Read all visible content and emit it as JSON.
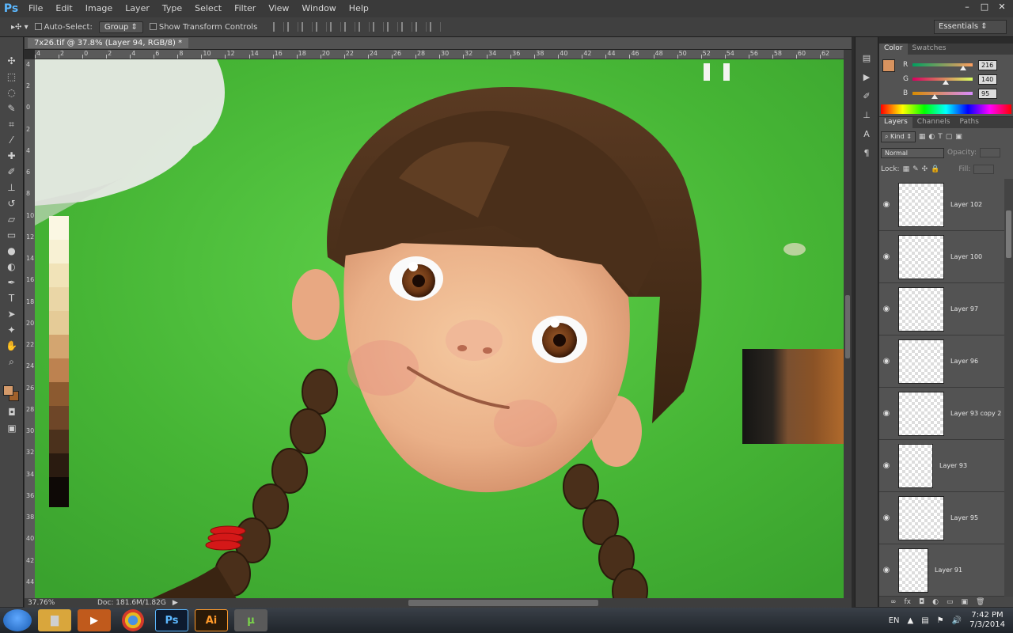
{
  "app": {
    "logo": "Ps",
    "doc_tab": "7x26.tif @ 37.8% (Layer 94, RGB/8) *"
  },
  "menu": [
    "File",
    "Edit",
    "Image",
    "Layer",
    "Type",
    "Select",
    "Filter",
    "View",
    "Window",
    "Help"
  ],
  "window_controls": [
    "–",
    "□",
    "✕"
  ],
  "options": {
    "auto_select_label": "Auto-Select:",
    "auto_select_value": "Group",
    "transform_label": "Show Transform Controls",
    "workspace": "Essentials"
  },
  "rulers": {
    "top": [
      "4",
      "2",
      "0",
      "2",
      "4",
      "6",
      "8",
      "10",
      "12",
      "14",
      "16",
      "18",
      "20",
      "22",
      "24",
      "26",
      "28",
      "30",
      "32",
      "34",
      "36",
      "38",
      "40",
      "42",
      "44",
      "46",
      "48",
      "50",
      "52",
      "54",
      "56",
      "58",
      "60",
      "62"
    ],
    "left": [
      "4",
      "2",
      "0",
      "2",
      "4",
      "6",
      "8",
      "10",
      "12",
      "14",
      "16",
      "18",
      "20",
      "22",
      "24",
      "26",
      "28",
      "30",
      "32",
      "34",
      "36",
      "38",
      "40",
      "42",
      "44"
    ]
  },
  "status": {
    "zoom": "37.76%",
    "doc": "Doc: 181.6M/1.82G"
  },
  "color_panel": {
    "tabs": [
      "Color",
      "Swatches"
    ],
    "channels": [
      {
        "label": "R",
        "value": "216",
        "fraction": 0.847,
        "gradient": "linear-gradient(to right,#009f5f,#ff9f5f)"
      },
      {
        "label": "G",
        "value": "140",
        "fraction": 0.549,
        "gradient": "linear-gradient(to right,#d8005f,#d8ff5f)"
      },
      {
        "label": "B",
        "value": "95",
        "fraction": 0.373,
        "gradient": "linear-gradient(to right,#d88c00,#d88cff)"
      }
    ],
    "fg_color": "#d8935f",
    "bg_color": "#a0602a"
  },
  "layers_panel": {
    "tabs": [
      "Layers",
      "Channels",
      "Paths"
    ],
    "kind_label": "Kind",
    "blend_mode": "Normal",
    "opacity_label": "Opacity:",
    "lock_label": "Lock:",
    "fill_label": "Fill:",
    "layers": [
      {
        "name": "Layer 102"
      },
      {
        "name": "Layer 100"
      },
      {
        "name": "Layer 97"
      },
      {
        "name": "Layer 96"
      },
      {
        "name": "Layer 93 copy 2"
      },
      {
        "name": "Layer 93"
      },
      {
        "name": "Layer 95"
      },
      {
        "name": "Layer 91"
      }
    ]
  },
  "taskbar": {
    "apps": [
      {
        "name": "Explorer",
        "icon": "folder-icon"
      },
      {
        "name": "Media Player",
        "icon": "media-icon"
      },
      {
        "name": "Chrome",
        "icon": "chrome-icon"
      },
      {
        "name": "Photoshop",
        "label": "Ps"
      },
      {
        "name": "Illustrator",
        "label": "Ai"
      },
      {
        "name": "uTorrent",
        "icon": "utorrent-icon"
      }
    ],
    "lang": "EN",
    "time": "7:42 PM",
    "date": "7/3/2014"
  }
}
